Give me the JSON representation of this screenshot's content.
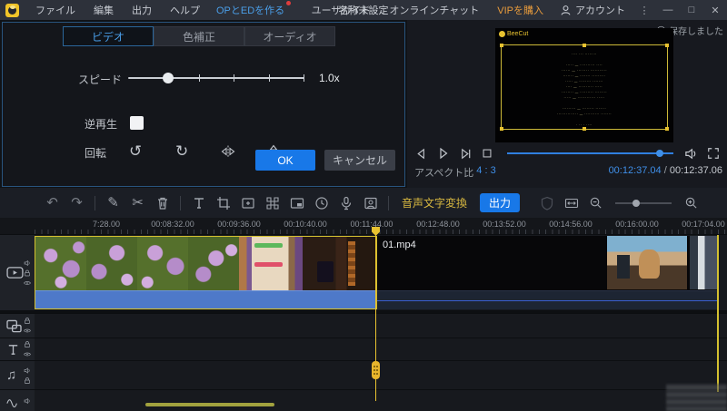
{
  "menubar": {
    "logo": "BeeCut",
    "menus": [
      "ファイル",
      "編集",
      "出力",
      "ヘルプ"
    ],
    "op_ed_label": "OPとEDを作る",
    "doc_title": "名称未設定",
    "user_guide": "ユーザガイド",
    "online_chat": "オンラインチャット",
    "buy_vip": "VIPを購入",
    "account": "アカウント",
    "more": "⋮",
    "minimize": "—",
    "maximize": "□",
    "close": "✕"
  },
  "edit_panel": {
    "tabs": [
      {
        "label": "ビデオ",
        "active": true
      },
      {
        "label": "色補正",
        "active": false
      },
      {
        "label": "オーディオ",
        "active": false
      }
    ],
    "speed_label": "スピード",
    "speed_value": "1.0x",
    "reverse_label": "逆再生",
    "rotate_label": "回転",
    "rotate_ccw": "↺",
    "rotate_cw": "↻",
    "ok_label": "OK",
    "cancel_label": "キャンセル"
  },
  "preview": {
    "saved_toast": "保存しました",
    "watermark": "BeeCut",
    "credits_lines": [
      "···· ··· ········",
      "",
      "····· — ·········· ····",
      "······ — ········ ···········",
      "······· — ······· ·········",
      "····· — ········ ·······",
      "···· — ·········· ·····",
      "········ — ········· ········",
      "····· — ············ ·····",
      "",
      "········· — ········ ·······",
      "·············· — ·········· ·······",
      "",
      "· ·· · ····",
      "··· ···· ···· ···"
    ],
    "aspect_label": "アスペクト比",
    "aspect_value": "4 : 3",
    "time_current": "00:12:37.04",
    "time_separator": "/",
    "time_total": "00:12:37.06"
  },
  "toolbar": {
    "undo": "↶",
    "redo": "↷",
    "pencil": "✎",
    "scissors": "✂",
    "stt_label": "音声文字変換",
    "export_label": "出力"
  },
  "timeline": {
    "ruler_labels": [
      "7:28.00",
      "00:08:32.00",
      "00:09:36.00",
      "00:10:40.00",
      "00:11:44.00",
      "00:12:48.00",
      "00:13:52.00",
      "00:14:56.00",
      "00:16:00.00",
      "00:17:04.00"
    ],
    "clip2_name": "01.mp4",
    "music_note": "♫"
  },
  "colors": {
    "accent_blue": "#1878e8",
    "link_blue": "#4a9ee8",
    "vip_orange": "#e89b3c",
    "selection_yellow": "#e8c230",
    "stt_yellow": "#d8b840"
  }
}
